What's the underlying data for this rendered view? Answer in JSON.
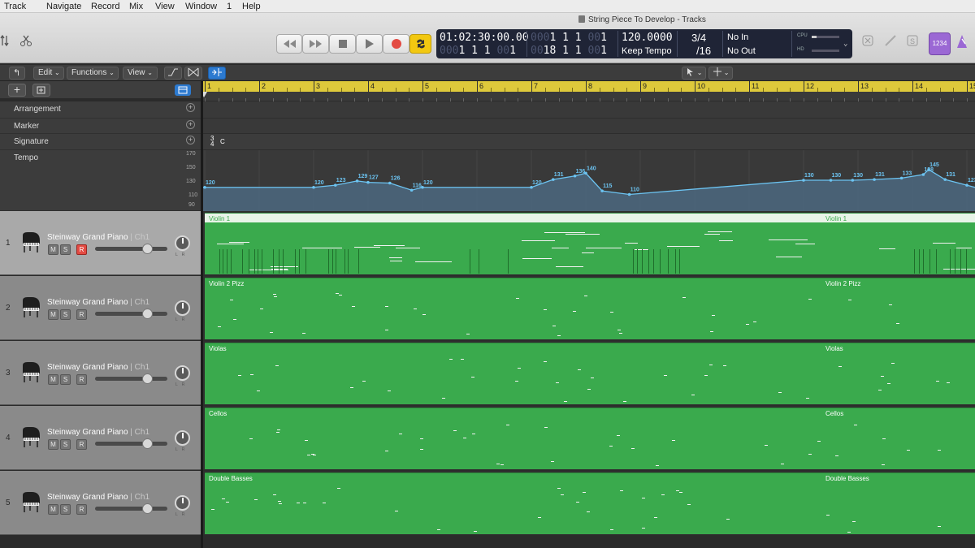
{
  "menubar": [
    "Track",
    "Navigate",
    "Record",
    "Mix",
    "View",
    "Window",
    "1",
    "Help"
  ],
  "window_title": "String Piece To Develop - Tracks",
  "transport": {
    "buttons": [
      "rewind-button",
      "forward-button",
      "stop-button",
      "play-button",
      "record-button",
      "cycle-button"
    ]
  },
  "lcd": {
    "smpte": "01:02:30:00.00",
    "bars_dim": "000",
    "bars": "1  1  1",
    "ticks_dim": "00",
    "ticks": "1",
    "pos_dim": "000",
    "pos": "1  1  1",
    "pos_ticks_dim": "00",
    "pos_ticks": "1",
    "end_dim": "00",
    "end": "18  1  1",
    "end_ticks_dim": "00",
    "end_ticks": "1",
    "tempo": "120.0000",
    "tempo_mode": "Keep Tempo",
    "sig_top": "3/4",
    "sig_bottom": "/16",
    "in": "No In",
    "out": "No Out",
    "cpu": "CPU",
    "hd": "HD"
  },
  "toolbar_right": {
    "count_in": "1234"
  },
  "region_bar": {
    "edit": "Edit",
    "functions": "Functions",
    "view": "View"
  },
  "global_tracks": [
    {
      "label": "Arrangement"
    },
    {
      "label": "Marker"
    },
    {
      "label": "Signature"
    },
    {
      "label": "Tempo"
    }
  ],
  "signature": {
    "num": "3",
    "den": "4",
    "key": "C"
  },
  "tempo_axis": [
    "170",
    "150",
    "130",
    "110",
    "90"
  ],
  "tempo_points": [
    {
      "bar": 1.0,
      "bpm": 120,
      "label": "120"
    },
    {
      "bar": 3.0,
      "bpm": 120,
      "label": "120"
    },
    {
      "bar": 3.4,
      "bpm": 123,
      "label": "123"
    },
    {
      "bar": 3.8,
      "bpm": 129,
      "label": "129"
    },
    {
      "bar": 4.0,
      "bpm": 127,
      "label": "127"
    },
    {
      "bar": 4.4,
      "bpm": 126,
      "label": "126"
    },
    {
      "bar": 4.8,
      "bpm": 116,
      "label": "116"
    },
    {
      "bar": 5.0,
      "bpm": 120,
      "label": "120"
    },
    {
      "bar": 7.0,
      "bpm": 120,
      "label": "120"
    },
    {
      "bar": 7.4,
      "bpm": 131,
      "label": "131"
    },
    {
      "bar": 7.8,
      "bpm": 136,
      "label": "136"
    },
    {
      "bar": 8.0,
      "bpm": 140,
      "label": "140"
    },
    {
      "bar": 8.3,
      "bpm": 115,
      "label": "115"
    },
    {
      "bar": 8.8,
      "bpm": 110,
      "label": "110"
    },
    {
      "bar": 12.0,
      "bpm": 130,
      "label": "130"
    },
    {
      "bar": 12.5,
      "bpm": 130,
      "label": "130"
    },
    {
      "bar": 12.9,
      "bpm": 130,
      "label": "130"
    },
    {
      "bar": 13.3,
      "bpm": 131,
      "label": "131"
    },
    {
      "bar": 13.8,
      "bpm": 133,
      "label": "133"
    },
    {
      "bar": 14.2,
      "bpm": 138,
      "label": "138"
    },
    {
      "bar": 14.3,
      "bpm": 145,
      "label": "145"
    },
    {
      "bar": 14.6,
      "bpm": 131,
      "label": "131"
    },
    {
      "bar": 15.0,
      "bpm": 123,
      "label": "123"
    }
  ],
  "ruler_bars": [
    "1",
    "2",
    "3",
    "4",
    "5",
    "6",
    "7",
    "8",
    "9",
    "10",
    "11",
    "12",
    "13",
    "14",
    "15"
  ],
  "tracks": [
    {
      "num": "1",
      "name": "Steinway Grand Piano",
      "ch": "| Ch1",
      "region": "Violin 1",
      "region2": "Violin 1",
      "m": "M",
      "s": "S",
      "r": "R",
      "rec": true,
      "selected": true
    },
    {
      "num": "2",
      "name": "Steinway Grand Piano",
      "ch": "| Ch1",
      "region": "Violin 2 Pizz",
      "region2": "Violin 2 Pizz",
      "m": "M",
      "s": "S",
      "r": "R",
      "rec": false,
      "selected": false
    },
    {
      "num": "3",
      "name": "Steinway Grand Piano",
      "ch": "| Ch1",
      "region": "Violas",
      "region2": "Violas",
      "m": "M",
      "s": "S",
      "r": "R",
      "rec": false,
      "selected": false
    },
    {
      "num": "4",
      "name": "Steinway Grand Piano",
      "ch": "| Ch1",
      "region": "Cellos",
      "region2": "Cellos",
      "m": "M",
      "s": "S",
      "r": "R",
      "rec": false,
      "selected": false
    },
    {
      "num": "5",
      "name": "Steinway Grand Piano",
      "ch": "| Ch1",
      "region": "Double Basses",
      "region2": "Double Basses",
      "m": "M",
      "s": "S",
      "r": "R",
      "rec": false,
      "selected": false
    }
  ],
  "colors": {
    "region": "#3aaa4d",
    "ruler": "#dec93b",
    "tempo": "#6cc4f2",
    "record": "#e34b43",
    "cycle": "#f2c811"
  }
}
